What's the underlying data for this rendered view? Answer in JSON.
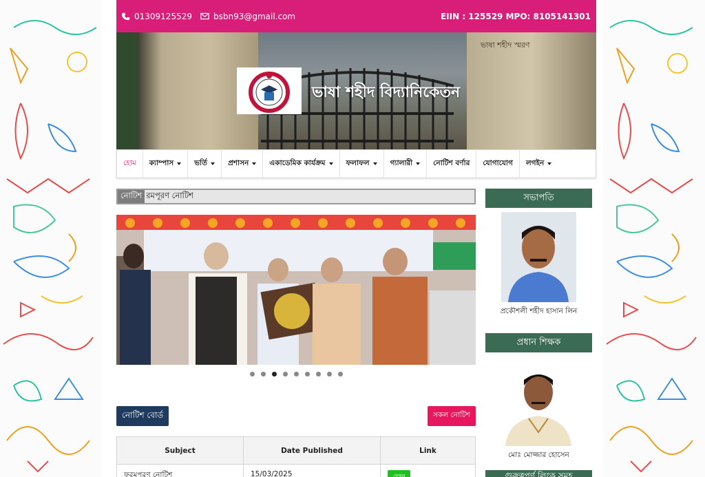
{
  "topbar": {
    "phone": "01309125529",
    "email": "bsbn93@gmail.com",
    "eiin": "EIIN : 125529 MPO: 8105141301",
    "icons": [
      "phone-icon",
      "envelope-icon"
    ],
    "bg_color": "#d91e7a"
  },
  "banner": {
    "school_name": "ভাষা শহীদ বিদ্যানিকেতন",
    "gate_sign": "ভাষা শহীদ স্মরণ"
  },
  "nav": {
    "items": [
      {
        "label": "হোম",
        "has_dropdown": false,
        "active": true
      },
      {
        "label": "ক্যাম্পাস",
        "has_dropdown": true
      },
      {
        "label": "ভর্তি",
        "has_dropdown": true
      },
      {
        "label": "প্রশাসন",
        "has_dropdown": true
      },
      {
        "label": "একাডেমিক কার্যক্রম",
        "has_dropdown": true
      },
      {
        "label": "ফলাফল",
        "has_dropdown": true
      },
      {
        "label": "গ্যালারী",
        "has_dropdown": true
      },
      {
        "label": "নোটিশ বর্ণার",
        "has_dropdown": false
      },
      {
        "label": "যোগাযোগ",
        "has_dropdown": false
      },
      {
        "label": "লগইন",
        "has_dropdown": true
      }
    ]
  },
  "ticker": {
    "label": "নোটিশ",
    "text": "রমপূরণ নোটিশ"
  },
  "slider": {
    "dot_count": 9,
    "active_index": 2
  },
  "notice_board": {
    "title": "নোটিশ বোর্ড",
    "all_button": "সকল নোটিশ",
    "columns": [
      "Subject",
      "Date Published",
      "Link"
    ],
    "rows": [
      {
        "subject": "ফরমপূরণ নোটিশ",
        "date": "15/03/2025",
        "link": "দেখুন"
      }
    ]
  },
  "sidebar": {
    "chairman": {
      "heading": "সভাপতি",
      "name": "প্রকৌশলী শহীদ হাসান লিন"
    },
    "headmaster": {
      "heading": "প্রধান শিক্ষক",
      "name": "মোঃ মোজ্জার হোসেন"
    },
    "next_heading": "গুরুত্বপূর্ণ লিংক সমূহ"
  }
}
